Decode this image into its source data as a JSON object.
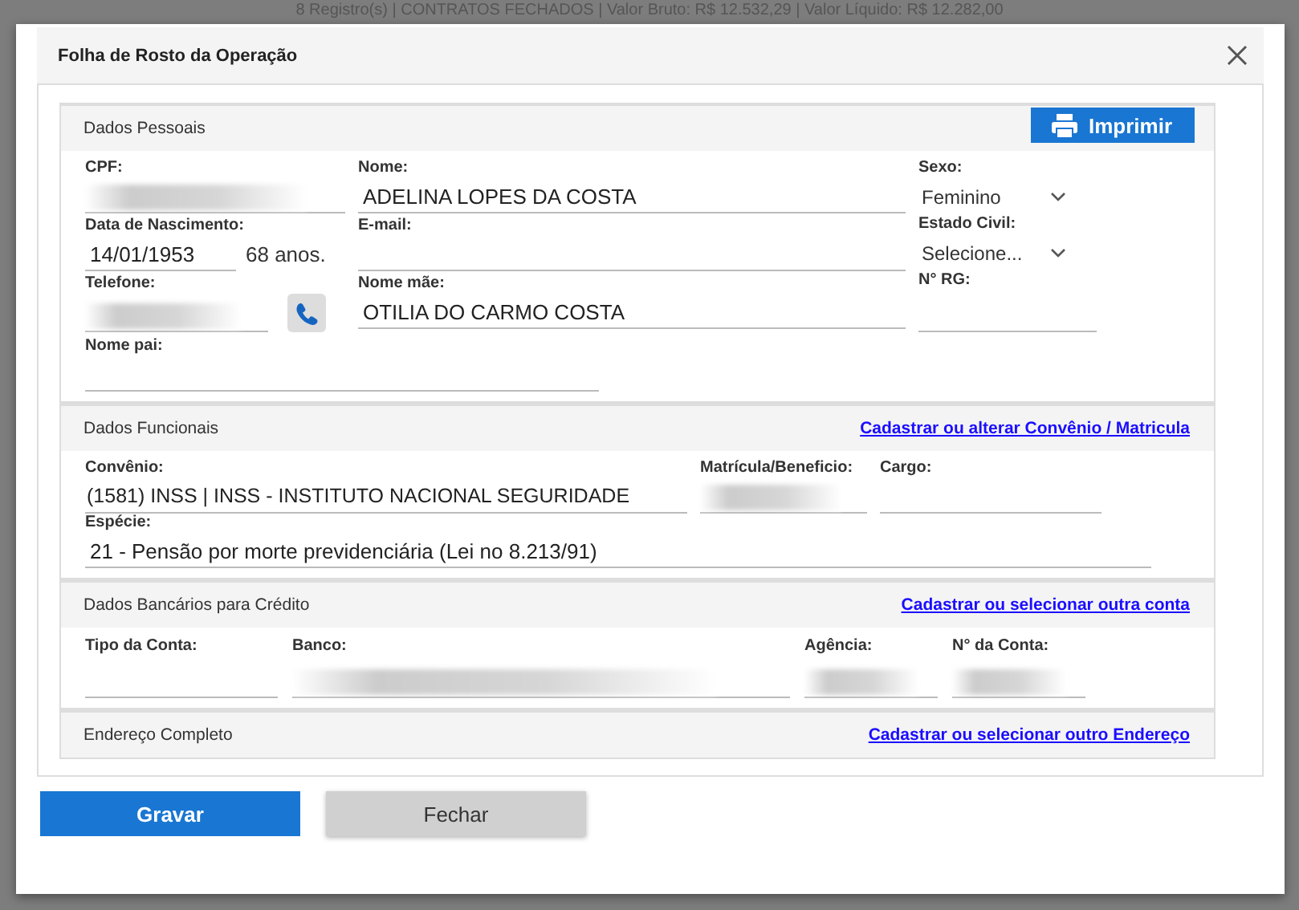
{
  "background_bar": {
    "text": "8 Registro(s) | CONTRATOS FECHADOS | Valor Bruto: R$ 12.532,29 | Valor Líquido: R$ 12.282,00"
  },
  "dialog": {
    "title": "Folha de Rosto da Operação"
  },
  "personal": {
    "title": "Dados Pessoais",
    "print_button": "Imprimir",
    "column_1": [
      {
        "kind": "text",
        "label": "CPF:",
        "redacted": true
      },
      {
        "kind": "date_age",
        "label": "Data de Nascimento:",
        "value": "14/01/1953",
        "age": "68 anos."
      },
      {
        "kind": "phone",
        "label": "Telefone:",
        "redacted": true
      }
    ],
    "column_2": [
      {
        "kind": "text",
        "label": "Nome:",
        "value": "ADELINA LOPES DA COSTA"
      },
      {
        "kind": "text",
        "label": "E-mail:"
      },
      {
        "kind": "text",
        "label": "Nome mãe:",
        "value": "OTILIA DO CARMO COSTA"
      }
    ],
    "column_3": [
      {
        "kind": "select",
        "label": "Sexo:",
        "value": "Feminino"
      },
      {
        "kind": "select",
        "label": "Estado Civil:",
        "value": "Selecione..."
      },
      {
        "kind": "text",
        "label": "N° RG:"
      }
    ],
    "father": {
      "kind": "text",
      "label": "Nome pai:"
    }
  },
  "functional": {
    "title": "Dados Funcionais",
    "link": "Cadastrar ou alterar Convênio / Matricula",
    "row_1": [
      {
        "kind": "text",
        "label": "Convênio:",
        "value": "(1581) INSS | INSS - INSTITUTO NACIONAL SEGURIDADE"
      },
      {
        "kind": "text",
        "label": "Matrícula/Beneficio:",
        "redacted": true
      },
      {
        "kind": "text",
        "label": "Cargo:"
      }
    ],
    "row_2": [
      {
        "kind": "text",
        "label": "Espécie:",
        "value": "21 - Pensão por morte previdenciária (Lei no 8.213/91)"
      }
    ]
  },
  "banking": {
    "title": "Dados Bancários para Crédito",
    "link": "Cadastrar ou selecionar outra conta",
    "fields": [
      {
        "kind": "text",
        "label": "Tipo da Conta:"
      },
      {
        "kind": "text",
        "label": "Banco:",
        "redacted": true
      },
      {
        "kind": "text",
        "label": "Agência:",
        "redacted": true
      },
      {
        "kind": "text",
        "label": "N° da Conta:",
        "redacted": true
      }
    ]
  },
  "address": {
    "title": "Endereço Completo",
    "link": "Cadastrar ou selecionar outro Endereço"
  },
  "buttons": [
    {
      "kind": "primary",
      "label": "Gravar"
    },
    {
      "kind": "secondary",
      "label": "Fechar"
    }
  ]
}
